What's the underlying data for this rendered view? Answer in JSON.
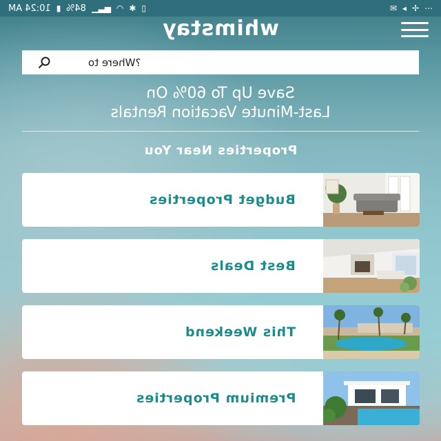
{
  "status_bar": {
    "time": "10:24 AM",
    "battery": "84%",
    "icons": [
      "wifi-icon",
      "signal-icon",
      "bluetooth-icon",
      "nfc-icon",
      "location-icon",
      "fan-icon",
      "alarm-icon",
      "overflow-icon"
    ]
  },
  "header": {
    "logo": "whimstay"
  },
  "search": {
    "placeholder": "Where to?"
  },
  "promo": {
    "line1": "Save Up To 60% On",
    "line2": "Last-Minute Vacation Rentals"
  },
  "section_title": "Properties Near You",
  "cards": [
    {
      "label": "Budget Properties"
    },
    {
      "label": "Best Deals"
    },
    {
      "label": "This Weekend"
    },
    {
      "label": "Premium Properties"
    }
  ]
}
